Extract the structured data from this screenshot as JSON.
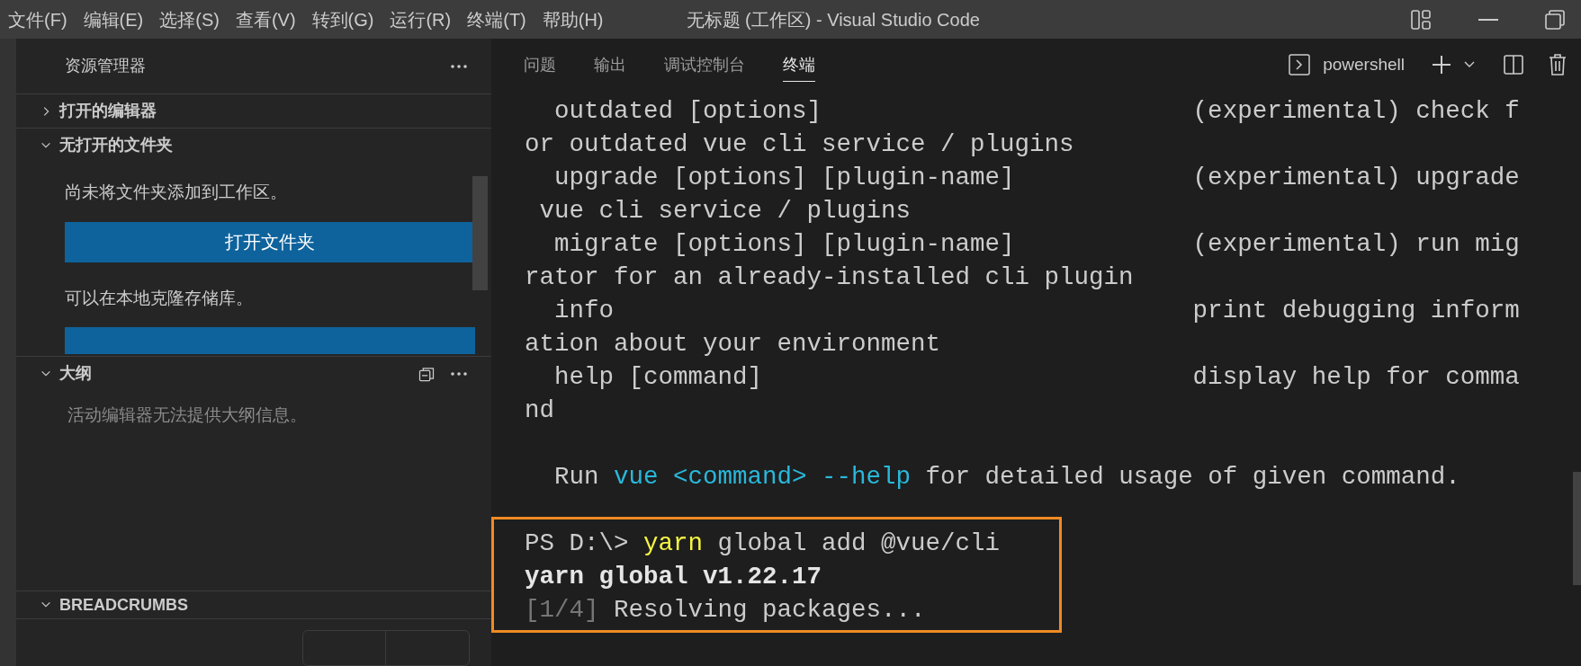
{
  "menu": [
    "文件(F)",
    "编辑(E)",
    "选择(S)",
    "查看(V)",
    "转到(G)",
    "运行(R)",
    "终端(T)",
    "帮助(H)"
  ],
  "window": {
    "title": "无标题 (工作区) - Visual Studio Code"
  },
  "sidebar": {
    "title": "资源管理器",
    "sections": [
      {
        "kind": "editors",
        "label": "打开的编辑器",
        "expanded": false
      },
      {
        "kind": "folder",
        "label": "无打开的文件夹",
        "expanded": true,
        "message": "尚未将文件夹添加到工作区。",
        "button": "打开文件夹",
        "message_2": "可以在本地克隆存储库。"
      },
      {
        "kind": "outline",
        "label": "大纲",
        "expanded": true,
        "message": "活动编辑器无法提供大纲信息。"
      },
      {
        "kind": "breadcrumbs",
        "label": "BREADCRUMBS",
        "expanded": true
      }
    ]
  },
  "panel": {
    "tabs": [
      {
        "label": "问题",
        "selected": false
      },
      {
        "label": "输出",
        "selected": false
      },
      {
        "label": "调试控制台",
        "selected": false
      },
      {
        "label": "终端",
        "selected": true
      }
    ],
    "shell": "powershell",
    "lines": [
      {
        "kind": "text",
        "segments": [
          {
            "kind": "plain",
            "text": "  outdated [options]                         (experimental) check f"
          }
        ]
      },
      {
        "kind": "text",
        "segments": [
          {
            "kind": "plain",
            "text": "or outdated vue cli service / plugins"
          }
        ]
      },
      {
        "kind": "text",
        "segments": [
          {
            "kind": "plain",
            "text": "  upgrade [options] [plugin-name]            (experimental) upgrade"
          }
        ]
      },
      {
        "kind": "text",
        "segments": [
          {
            "kind": "plain",
            "text": " vue cli service / plugins"
          }
        ]
      },
      {
        "kind": "text",
        "segments": [
          {
            "kind": "plain",
            "text": "  migrate [options] [plugin-name]            (experimental) run mig"
          }
        ]
      },
      {
        "kind": "text",
        "segments": [
          {
            "kind": "plain",
            "text": "rator for an already-installed cli plugin"
          }
        ]
      },
      {
        "kind": "text",
        "segments": [
          {
            "kind": "plain",
            "text": "  info                                       print debugging inform"
          }
        ]
      },
      {
        "kind": "text",
        "segments": [
          {
            "kind": "plain",
            "text": "ation about your environment"
          }
        ]
      },
      {
        "kind": "text",
        "segments": [
          {
            "kind": "plain",
            "text": "  help [command]                             display help for comma"
          }
        ]
      },
      {
        "kind": "text",
        "segments": [
          {
            "kind": "plain",
            "text": "nd"
          }
        ]
      },
      {
        "kind": "blank"
      },
      {
        "kind": "text",
        "segments": [
          {
            "kind": "plain",
            "text": "  Run "
          },
          {
            "kind": "link",
            "text": "vue <command> --help"
          },
          {
            "kind": "plain",
            "text": " for detailed usage of given command."
          }
        ]
      },
      {
        "kind": "blank"
      },
      {
        "kind": "text",
        "segments": [
          {
            "kind": "plain",
            "text": "PS D:\\> "
          },
          {
            "kind": "command",
            "text": "yarn"
          },
          {
            "kind": "plain",
            "text": " global add @vue/cli"
          }
        ]
      },
      {
        "kind": "text",
        "segments": [
          {
            "kind": "bold",
            "text": "yarn global v1.22.17"
          }
        ]
      },
      {
        "kind": "text",
        "segments": [
          {
            "kind": "dim",
            "text": "[1/4]"
          },
          {
            "kind": "plain",
            "text": " Resolving packages..."
          }
        ]
      }
    ]
  }
}
